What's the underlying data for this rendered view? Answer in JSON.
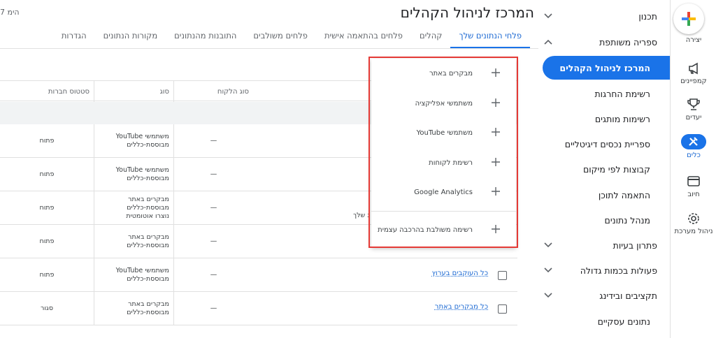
{
  "rail": {
    "create_label": "יצירה",
    "items": [
      {
        "label": "קמפיינים",
        "icon": "megaphone-icon"
      },
      {
        "label": "יעדים",
        "icon": "trophy-icon"
      },
      {
        "label": "כלים",
        "icon": "tools-icon",
        "active": true
      },
      {
        "label": "חיוב",
        "icon": "credit-card-icon"
      },
      {
        "label": "ניהול מערכת",
        "icon": "gear-icon"
      }
    ]
  },
  "nav": {
    "items": [
      {
        "label": "תכנון",
        "chevron": "down"
      },
      {
        "label": "ספריה משותפת",
        "chevron": "up"
      },
      {
        "label": "המרכז לניהול הקהלים",
        "selected": true
      },
      {
        "label": "רשימת החרגות"
      },
      {
        "label": "רשימות מותגים"
      },
      {
        "label": "ספריית נכסים דיגיטליים"
      },
      {
        "label": "קבוצות לפי מיקום"
      },
      {
        "label": "התאמה לתוכן"
      },
      {
        "label": "מנהל נתונים"
      },
      {
        "label": "פתרון בעיות",
        "chevron": "down"
      },
      {
        "label": "פעולות בכמות גדולה",
        "chevron": "down"
      },
      {
        "label": "תקציבים ובידינג",
        "chevron": "down"
      },
      {
        "label": "נתונים עסקיים"
      }
    ]
  },
  "header": {
    "title": "המרכז לניהול הקהלים",
    "corner_note": "7 הימ"
  },
  "tabs": [
    {
      "label": "פלחי הנתונים שלך",
      "active": true
    },
    {
      "label": "קהלים"
    },
    {
      "label": "פלחים בהתאמה אישית"
    },
    {
      "label": "פלחים משולבים"
    },
    {
      "label": "התובנות מהנתונים"
    },
    {
      "label": "מקורות הנתונים"
    },
    {
      "label": "הגדרות"
    }
  ],
  "table": {
    "columns": [
      "סטטוס חברות",
      "סוג",
      "סוג הלקוח"
    ],
    "rows": [
      {
        "status": "פתוח",
        "type_lines": [
          "משתמשי YouTube",
          "מבוססת-כללים"
        ],
        "customer": "—"
      },
      {
        "status": "פתוח",
        "type_lines": [
          "משתמשי YouTube",
          "מבוססת-כללים"
        ],
        "customer": "—"
      },
      {
        "status": "פתוח",
        "type_lines": [
          "מבקרים באתר",
          "מבוססת-כללים",
          "נוצרו אוטומטית"
        ],
        "customer": "—"
      },
      {
        "status": "פתוח",
        "type_lines": [
          "מבקרים באתר",
          "מבוססת-כללים"
        ],
        "customer": "—"
      },
      {
        "status": "פתוח",
        "type_lines": [
          "משתמשי YouTube",
          "מבוססת-כללים"
        ],
        "customer": "—",
        "name": "כל העוקבים בערוץ"
      },
      {
        "status": "סגור",
        "type_lines": [
          "מבקרים באתר",
          "מבוססת-כללים"
        ],
        "customer": "—",
        "name": "כל מבקרים באתר"
      }
    ],
    "partial_text": "ג שלך"
  },
  "dropdown": {
    "items": [
      "מבקרים באתר",
      "משתמשי אפליקציה",
      "משתמשי YouTube",
      "רשימת לקוחות",
      "Google Analytics",
      "רשימה משולבת בהרכבה עצמית"
    ]
  },
  "colors": {
    "accent": "#1a73e8",
    "highlight": "#e53935"
  }
}
